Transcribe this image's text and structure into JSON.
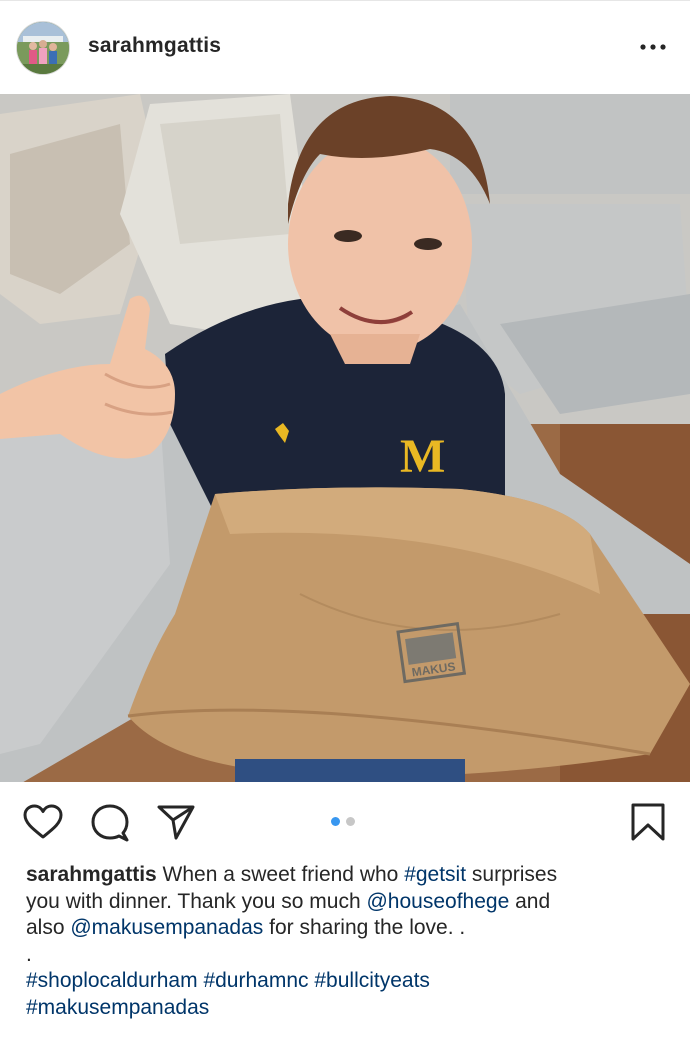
{
  "header": {
    "username": "sarahmgattis",
    "avatar_icon": "profile-photo",
    "more_icon": "more-horizontal-icon"
  },
  "post": {
    "image_description_icon": "photo",
    "carousel": {
      "count": 2,
      "active_index": 0,
      "active_color": "#3897f0",
      "inactive_color": "#c7c7c7"
    },
    "actions": [
      "heart-icon",
      "comment-icon",
      "share-icon",
      "bookmark-icon"
    ]
  },
  "caption": {
    "username": "sarahmgattis",
    "l1_a": " When a sweet friend who ",
    "l1_tag": "#getsit",
    "l1_b": " surprises",
    "l2_a": "you with dinner. Thank you so much ",
    "l2_mention": "@houseofhege",
    "l2_b": " and",
    "l3_a": "also ",
    "l3_mention": "@makusempanadas",
    "l3_b": " for sharing the love. .",
    "l4": ".",
    "tags_line1": [
      "#shoplocaldurham",
      "#durhamnc",
      "#bullcityeats"
    ],
    "tags_line2": [
      "#makusempanadas"
    ],
    "link_color": "#003569"
  },
  "photo_text": {
    "bag_stamp": "MAKUS",
    "shirt_letter": "M"
  }
}
